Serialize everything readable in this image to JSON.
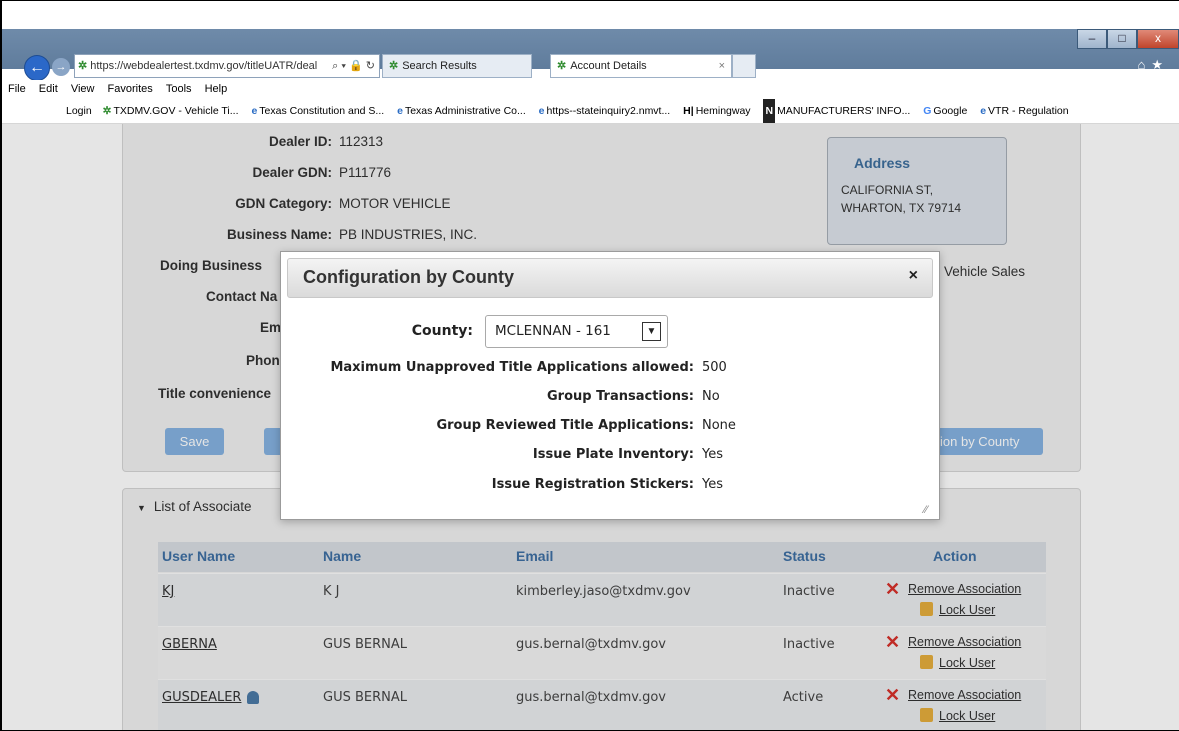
{
  "browser": {
    "address": "https://webdealertest.txdmv.gov/titleUATR/deal",
    "address_controls": "⌕ ▾ 🔒 ↻",
    "tabs": [
      {
        "label": "Search Results"
      },
      {
        "label": "Account Details"
      }
    ],
    "tab_close": "×",
    "menu": [
      "File",
      "Edit",
      "View",
      "Favorites",
      "Tools",
      "Help"
    ],
    "favorites": [
      "Login",
      "TXDMV.GOV - Vehicle Ti...",
      "Texas Constitution and S...",
      "Texas Administrative Co...",
      "https--stateinquiry2.nmvt...",
      "Hemingway",
      "MANUFACTURERS' INFO...",
      "Google",
      "VTR - Regulation"
    ],
    "window_controls": [
      "–",
      "□",
      "x"
    ]
  },
  "dealer": {
    "fields": [
      {
        "label": "Dealer ID:",
        "value": "112313"
      },
      {
        "label": "Dealer GDN:",
        "value": "P111776"
      },
      {
        "label": "GDN Category:",
        "value": "MOTOR VEHICLE"
      },
      {
        "label": "Business Name:",
        "value": "PB INDUSTRIES, INC."
      },
      {
        "label": "Doing Business",
        "value": ""
      },
      {
        "label": "Contact Na",
        "value": ""
      },
      {
        "label": "Em",
        "value": ""
      },
      {
        "label": "Phon",
        "value": ""
      },
      {
        "label": "Title convenience",
        "value": ""
      }
    ],
    "side_text": "Vehicle Sales",
    "address": {
      "title": "Address",
      "line1": "CALIFORNIA ST,",
      "line2": "WHARTON, TX 79714"
    },
    "buttons": {
      "save": "Save",
      "config_by_county": "ion by County"
    }
  },
  "users_panel": {
    "heading": "List of Associate",
    "columns": [
      "User Name",
      "Name",
      "Email",
      "Status",
      "Action"
    ],
    "rows": [
      {
        "username": "KJ",
        "name": "K J",
        "email": "kimberley.jaso@txdmv.gov",
        "status": "Inactive",
        "remove": "Remove Association",
        "lock": "Lock User"
      },
      {
        "username": "GBERNA",
        "name": "GUS BERNAL",
        "email": "gus.bernal@txdmv.gov",
        "status": "Inactive",
        "remove": "Remove Association",
        "lock": "Lock User"
      },
      {
        "username": "GUSDEALER",
        "name": "GUS BERNAL",
        "email": "gus.bernal@txdmv.gov",
        "status": "Active",
        "remove": "Remove Association",
        "lock": "Lock User"
      }
    ]
  },
  "modal": {
    "title": "Configuration by County",
    "close": "×",
    "county_label": "County:",
    "county_value": "MCLENNAN - 161",
    "settings": [
      {
        "label": "Maximum Unapproved Title Applications allowed:",
        "value": "500"
      },
      {
        "label": "Group Transactions:",
        "value": "No"
      },
      {
        "label": "Group Reviewed Title Applications:",
        "value": "None"
      },
      {
        "label": "Issue Plate Inventory:",
        "value": "Yes"
      },
      {
        "label": "Issue Registration Stickers:",
        "value": "Yes"
      }
    ]
  },
  "colors": {
    "accent_blue": "#3e6fa3",
    "button_blue": "#85b2e0",
    "remove_red": "#d6302a"
  }
}
